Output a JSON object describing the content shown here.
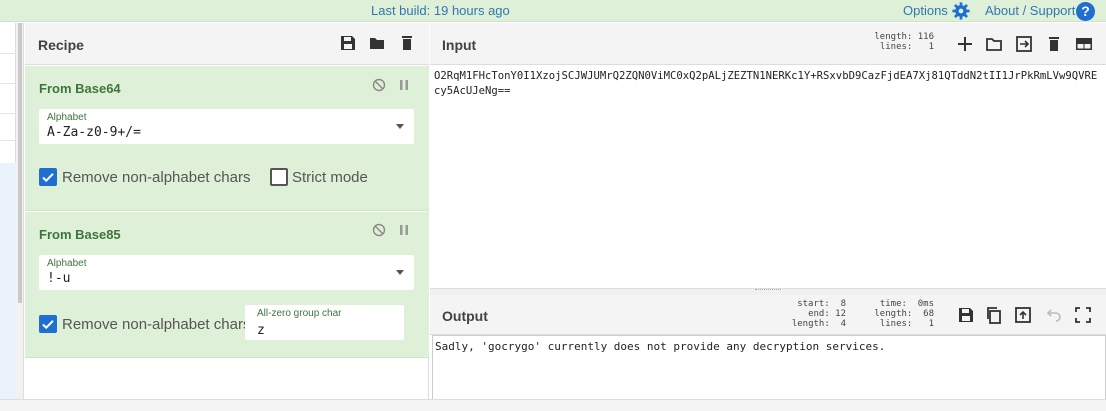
{
  "banner": {
    "last_build": "Last build: 19 hours ago",
    "options_label": "Options",
    "about_label": "About / Support",
    "help_glyph": "?"
  },
  "recipe": {
    "title": "Recipe",
    "header_icons": [
      "save-icon",
      "folder-icon",
      "trash-icon"
    ],
    "operations": [
      {
        "name": "From Base64",
        "alphabet_label": "Alphabet",
        "alphabet_value": "A-Za-z0-9+/=",
        "remove_nonalpha_label": "Remove non-alphabet chars",
        "remove_nonalpha_checked": true,
        "strict_mode_label": "Strict mode",
        "strict_mode_checked": false
      },
      {
        "name": "From Base85",
        "alphabet_label": "Alphabet",
        "alphabet_value": "!-u",
        "remove_nonalpha_label": "Remove non-alphabet chars",
        "remove_nonalpha_checked": true,
        "allzero_label": "All-zero group char",
        "allzero_value": "z"
      }
    ]
  },
  "input": {
    "title": "Input",
    "length_stat": "length: 116",
    "lines_stat": "lines:   1",
    "text": "O2RqM1FHcTonY0I1XzojSCJWJUMrQ2ZQN0ViMC0xQ2pALjZEZTN1NERKc1Y+RSxvbD9CazFjdEA7Xj81QTddN2tII1JrPkRmLVw9QVREcy5AcUJeNg=="
  },
  "output": {
    "title": "Output",
    "start_stat": "start:  8",
    "end_stat": "end: 12",
    "length_stat": "length:  4",
    "time_stat": "time:  0ms",
    "out_length_stat": "length:  68",
    "lines_stat": "lines:   1",
    "text": "Sadly, 'gocrygo' currently does not provide any decryption services."
  },
  "colors": {
    "banner_bg": "#dff0d8",
    "op_bg": "#dff0d8",
    "link": "#3276b1",
    "checkbox": "#1f6fd1",
    "op_title": "#3c763d"
  }
}
